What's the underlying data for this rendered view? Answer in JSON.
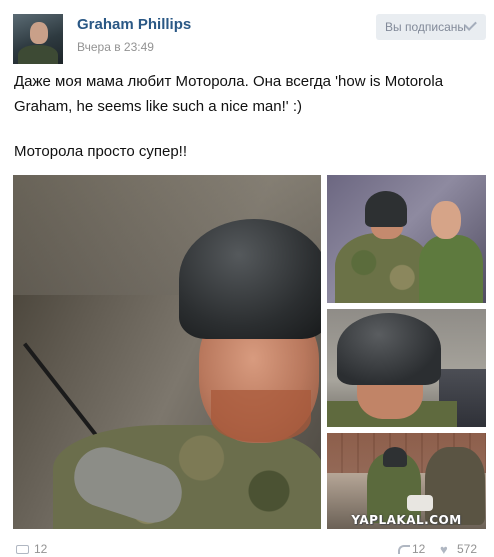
{
  "post": {
    "author": "Graham Phillips",
    "timestamp": "Вчера в 23:49",
    "subscribe_label": "Вы подписаны",
    "text_lines": [
      "Даже моя мама любит Моторола. Она всегда 'how is Motorola",
      "Graham, he seems like such a nice man!' :)",
      "",
      "Моторола просто супер!!"
    ],
    "watermark": "YAPLAKAL.COM",
    "counts": {
      "comments": "12",
      "shares": "12",
      "likes": "572"
    }
  }
}
